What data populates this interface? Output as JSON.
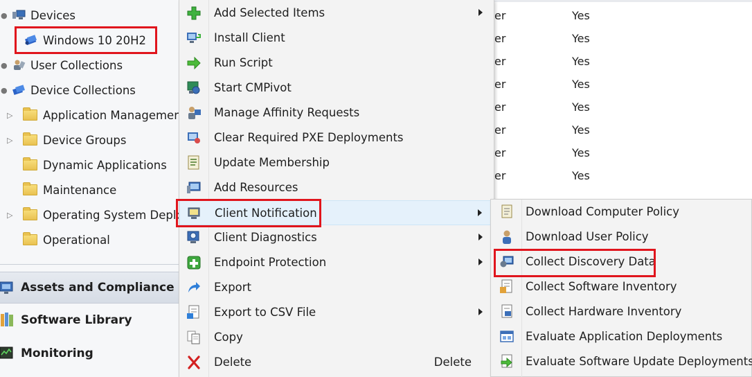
{
  "nav": {
    "tree": [
      {
        "label": "Devices"
      },
      {
        "label": "Windows 10 20H2"
      },
      {
        "label": "User Collections"
      },
      {
        "label": "Device Collections"
      },
      {
        "label": "Application Management"
      },
      {
        "label": "Device Groups"
      },
      {
        "label": "Dynamic Applications"
      },
      {
        "label": "Maintenance"
      },
      {
        "label": "Operating System Deployment"
      },
      {
        "label": "Operational"
      }
    ],
    "workspaces": [
      {
        "label": "Assets and Compliance"
      },
      {
        "label": "Software Library"
      },
      {
        "label": "Monitoring"
      }
    ]
  },
  "list": {
    "rows": [
      {
        "c1": "er",
        "c2": "Yes"
      },
      {
        "c1": "er",
        "c2": "Yes"
      },
      {
        "c1": "er",
        "c2": "Yes"
      },
      {
        "c1": "er",
        "c2": "Yes"
      },
      {
        "c1": "er",
        "c2": "Yes"
      },
      {
        "c1": "er",
        "c2": "Yes"
      },
      {
        "c1": "er",
        "c2": "Yes"
      },
      {
        "c1": "er",
        "c2": "Yes"
      }
    ]
  },
  "context_menu": {
    "items": [
      {
        "label": "Add Selected Items",
        "icon": "green-plus-icon"
      },
      {
        "label": "Install Client",
        "icon": "install-client-icon"
      },
      {
        "label": "Run Script",
        "icon": "green-arrow-icon"
      },
      {
        "label": "Start CMPivot",
        "icon": "cmpivot-icon"
      },
      {
        "label": "Manage Affinity Requests",
        "icon": "affinity-icon"
      },
      {
        "label": "Clear Required PXE Deployments",
        "icon": "pxe-icon"
      },
      {
        "label": "Update Membership",
        "icon": "update-membership-icon"
      },
      {
        "label": "Add Resources",
        "icon": "add-resources-icon"
      },
      {
        "label": "Client Notification",
        "icon": "client-notification-icon"
      },
      {
        "label": "Client Diagnostics",
        "icon": "client-diagnostics-icon"
      },
      {
        "label": "Endpoint Protection",
        "icon": "endpoint-protection-icon"
      },
      {
        "label": "Export",
        "icon": "export-arrow-icon"
      },
      {
        "label": "Export to CSV File",
        "icon": "csv-export-icon"
      },
      {
        "label": "Copy",
        "icon": "copy-icon"
      },
      {
        "label": "Delete",
        "icon": "red-x-icon",
        "shortcut": "Delete"
      }
    ]
  },
  "submenu": {
    "items": [
      {
        "label": "Download Computer Policy",
        "icon": "computer-policy-icon"
      },
      {
        "label": "Download User Policy",
        "icon": "user-policy-icon"
      },
      {
        "label": "Collect Discovery Data",
        "icon": "discovery-data-icon"
      },
      {
        "label": "Collect Software Inventory",
        "icon": "software-inventory-icon"
      },
      {
        "label": "Collect Hardware Inventory",
        "icon": "hardware-inventory-icon"
      },
      {
        "label": "Evaluate Application Deployments",
        "icon": "app-deployments-icon"
      },
      {
        "label": "Evaluate Software Update Deployments",
        "icon": "update-deployments-icon"
      }
    ]
  },
  "colors": {
    "highlight": "#e0151d",
    "hover": "#e5f1fb"
  }
}
